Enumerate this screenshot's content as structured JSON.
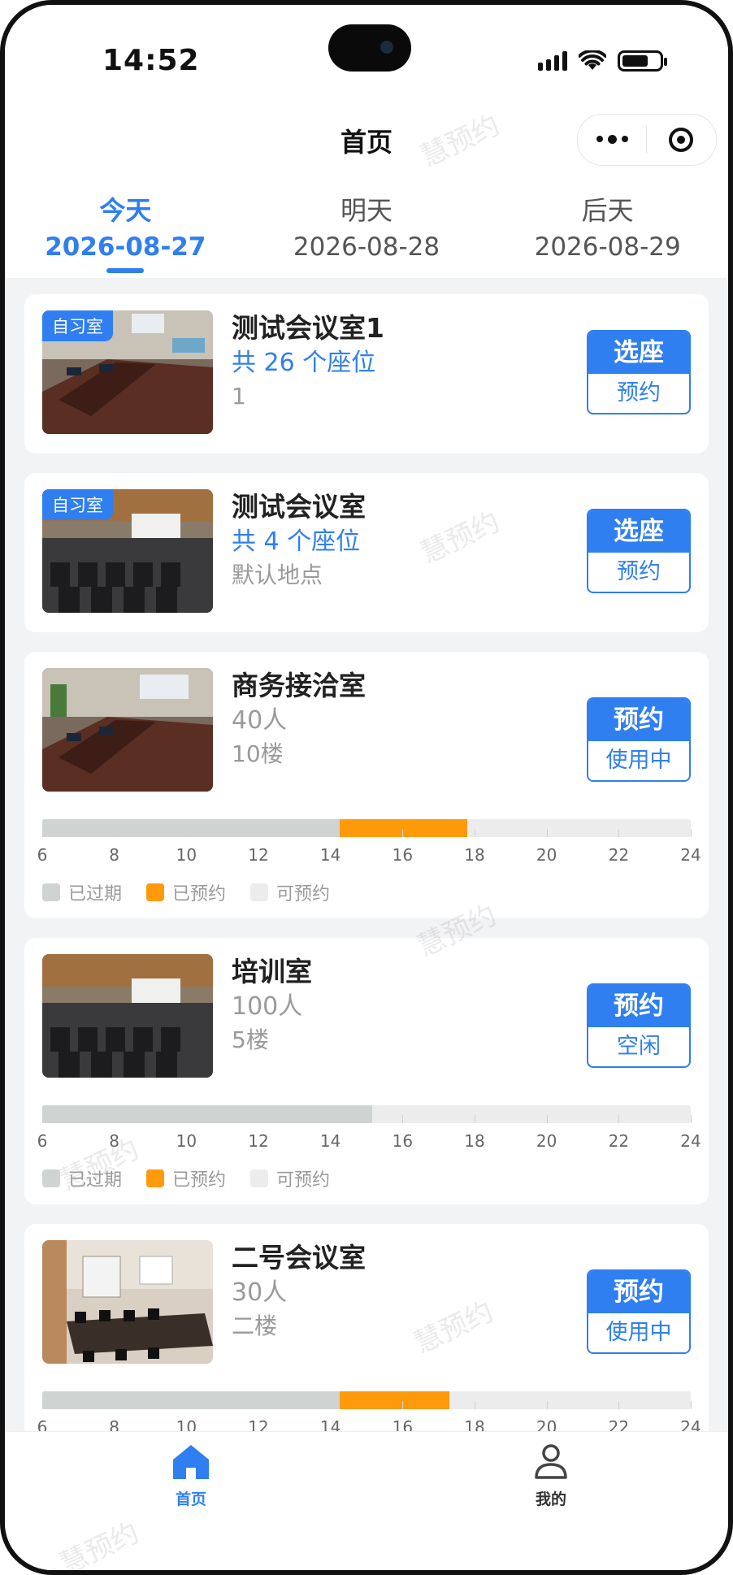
{
  "status_bar": {
    "time": "14:52"
  },
  "nav": {
    "title": "首页"
  },
  "day_tabs": [
    {
      "label": "今天",
      "date": "2026-08-27",
      "active": true
    },
    {
      "label": "明天",
      "date": "2026-08-28",
      "active": false
    },
    {
      "label": "后天",
      "date": "2026-08-29",
      "active": false
    }
  ],
  "timeline_hours": [
    "6",
    "8",
    "10",
    "12",
    "14",
    "16",
    "18",
    "20",
    "22",
    "24"
  ],
  "legend": {
    "expired": "已过期",
    "booked": "已预约",
    "available": "可预约"
  },
  "colors": {
    "accent": "#2f7ff0",
    "expired": "#cfd4d3",
    "booked": "#ff9a0a",
    "available": "#ececec"
  },
  "rooms": [
    {
      "tag": "自习室",
      "name": "测试会议室1",
      "line2": "共 26 个座位",
      "line3": "1",
      "btn_top": "选座",
      "btn_bottom": "预约"
    },
    {
      "tag": "自习室",
      "name": "测试会议室",
      "line2": "共 4 个座位",
      "line3": "默认地点",
      "btn_top": "选座",
      "btn_bottom": "预约"
    },
    {
      "name": "商务接洽室",
      "line2": "40人",
      "line3": "10楼",
      "btn_top": "预约",
      "btn_bottom": "使用中",
      "expired_until": 14.25,
      "booked": [
        14.25,
        17.8
      ]
    },
    {
      "name": "培训室",
      "line2": "100人",
      "line3": "5楼",
      "btn_top": "预约",
      "btn_bottom": "空闲",
      "expired_until": 15.15,
      "booked": null
    },
    {
      "name": "二号会议室",
      "line2": "30人",
      "line3": "二楼",
      "btn_top": "预约",
      "btn_bottom": "使用中",
      "expired_until": 14.25,
      "booked": [
        14.25,
        17.3
      ]
    }
  ],
  "tabbar": {
    "home": "首页",
    "mine": "我的"
  },
  "watermark": "慧预约"
}
